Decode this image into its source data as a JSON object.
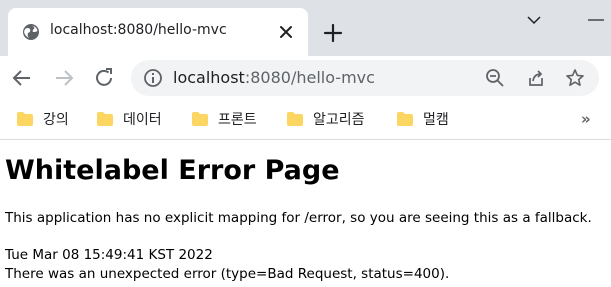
{
  "browser": {
    "tab": {
      "title": "localhost:8080/hello-mvc"
    },
    "address_bar": {
      "host": "localhost",
      "rest": ":8080/hello-mvc"
    },
    "bookmarks": [
      {
        "label": "강의"
      },
      {
        "label": "데이터"
      },
      {
        "label": "프론트"
      },
      {
        "label": "알고리즘"
      },
      {
        "label": "멀캠"
      }
    ],
    "bookmarks_more": "»"
  },
  "page": {
    "heading": "Whitelabel Error Page",
    "message": "This application has no explicit mapping for /error, so you are seeing this as a fallback.",
    "timestamp": "Tue Mar 08 15:49:41 KST 2022",
    "error": "There was an unexpected error (type=Bad Request, status=400)."
  },
  "colors": {
    "tabstrip_bg": "#dee1e6",
    "omnibox_bg": "#f1f3f4",
    "folder": "#fcd663",
    "icon": "#5f6368"
  }
}
